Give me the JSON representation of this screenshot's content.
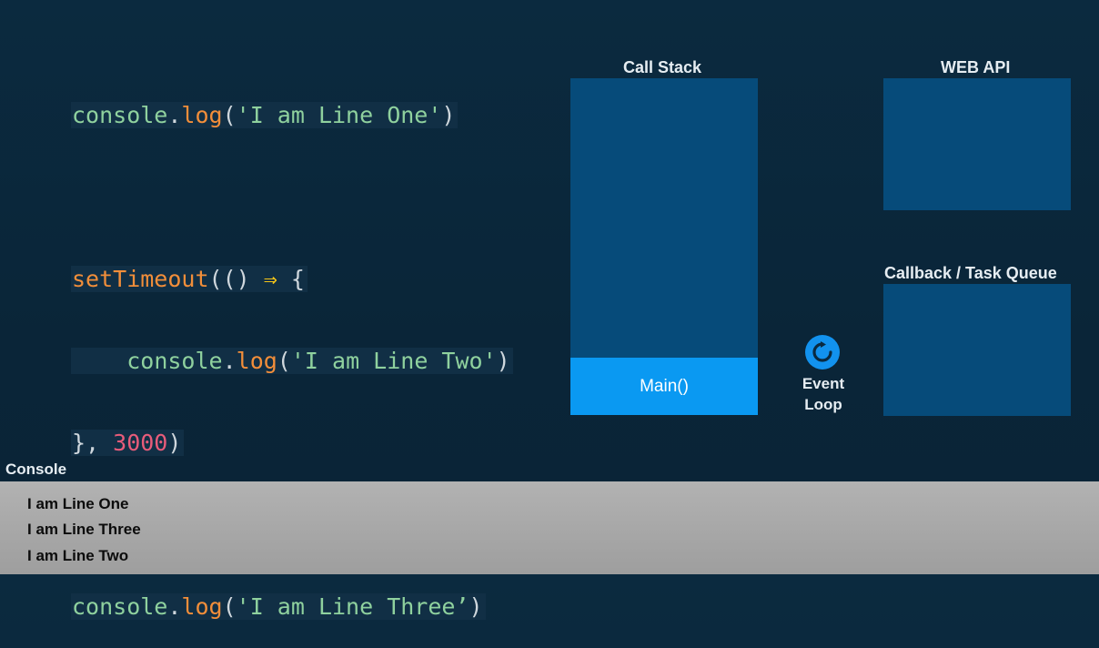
{
  "code": {
    "line1": {
      "obj": "console",
      "dot": ".",
      "method": "log",
      "open": "(",
      "str": "'I am Line One'",
      "close": ")"
    },
    "line2": {
      "fn": "setTimeout",
      "args": "(() ",
      "arrow": "⇒",
      "brace": " {"
    },
    "line3": {
      "indent": "    ",
      "obj": "console",
      "dot": ".",
      "method": "log",
      "open": "(",
      "str": "'I am Line Two'",
      "close": ")"
    },
    "line4": {
      "brace": "}, ",
      "num": "3000",
      "close": ")"
    },
    "line5": {
      "obj": "console",
      "dot": ".",
      "method": "log",
      "open": "(",
      "str": "'I am Line Three’",
      "close": ")"
    }
  },
  "labels": {
    "call_stack": "Call Stack",
    "web_api": "WEB API",
    "callback_queue": "Callback / Task Queue",
    "main_frame": "Main()",
    "event_loop_1": "Event",
    "event_loop_2": "Loop",
    "console": "Console"
  },
  "console_output": [
    "I am Line One",
    "I am Line Three",
    "I am Line Two"
  ],
  "colors": {
    "background": "#0b2a3f",
    "box": "#064b7a",
    "main_frame": "#0a99f2",
    "event_loop_icon": "#1292ee",
    "console_bg": "#a8a8a8"
  },
  "icons": {
    "event_loop": "refresh-icon"
  }
}
